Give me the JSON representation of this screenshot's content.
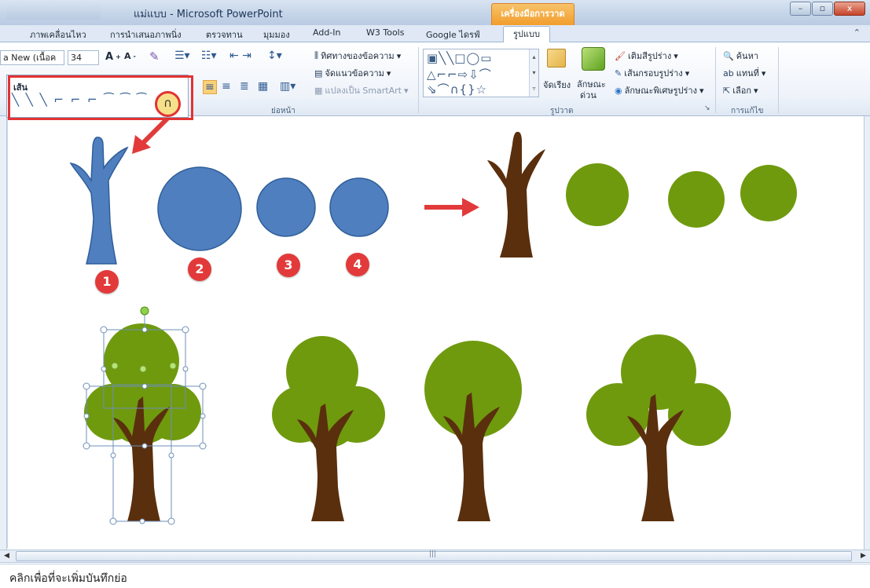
{
  "window": {
    "title": "แม่แบบ - Microsoft PowerPoint",
    "context_tab_header": "เครื่องมือการวาด",
    "controls": {
      "minimize": "–",
      "restore": "▫",
      "close": "x"
    }
  },
  "tabs": [
    "ภาพเคลื่อนไหว",
    "การนำเสนอภาพนิ่ง",
    "ตรวจทาน",
    "มุมมอง",
    "Add-In",
    "W3 Tools",
    "Google ไดรฟ์",
    "รูปแบบ"
  ],
  "ribbon": {
    "font_name": "a New (เนื้อค",
    "font_size": "34",
    "paragraph": {
      "text_direction": "ทิศทางของข้อความ",
      "align_text": "จัดแนวข้อความ",
      "convert_smartart": "แปลงเป็น SmartArt",
      "group_label": "ย่อหน้า"
    },
    "drawing": {
      "arrange": "จัดเรียง",
      "quick_styles": "ลักษณะ",
      "quick_styles_2": "ด่วน",
      "shape_fill": "เติมสีรูปร่าง",
      "shape_outline": "เส้นกรอบรูปร่าง",
      "shape_effects": "ลักษณะพิเศษรูปร่าง",
      "group_label": "รูปวาด"
    },
    "editing": {
      "find": "ค้นหา",
      "replace": "แทนที่",
      "select": "เลือก",
      "group_label": "การแก้ไข"
    },
    "line_popup": {
      "title": "เส้น",
      "icons": "╲ ╲ ╲ ⌐ ⌐ ⌐ ⁀ ⁀ ⁀"
    },
    "curve_icon": "∩"
  },
  "slide": {
    "badges": [
      "1",
      "2",
      "3",
      "4"
    ]
  },
  "colors": {
    "blue": "#4f7fbf",
    "blue_stroke": "#2f5e98",
    "green": "#6f9a0e",
    "trunk": "#5a2f0d",
    "red": "#e23a3a"
  },
  "notes": {
    "placeholder": "คลิกเพื่อที่จะเพิ่มบันทึกย่อ"
  }
}
